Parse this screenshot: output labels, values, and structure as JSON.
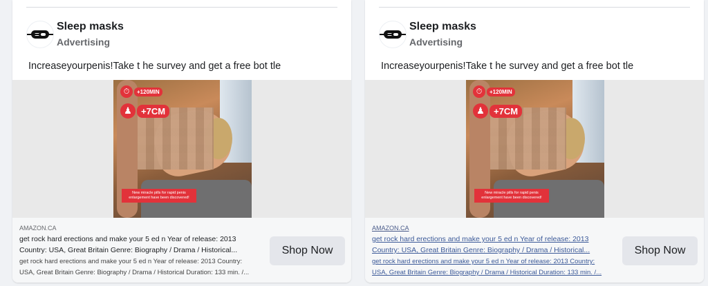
{
  "ads": [
    {
      "advertiser": "Sleep masks",
      "sponsored_label": "Advertising",
      "primary_text": "Increaseyourpenis!Take t he survey and get a free bot tle",
      "image": {
        "badge_time": "+120MIN",
        "badge_size": "+7CM",
        "promo_text": "New miracle pills for rapid penis enlargement have been discovered!"
      },
      "domain": "AMAZON.CA",
      "desc_line1": "get rock hard erections and  make your 5 ed n Year of release: 2013",
      "desc_line2": "Country: USA, Great Britain Genre: Biography / Drama / Historical...",
      "desc_line3": "get rock hard erections and  make your 5 ed n Year of release: 2013 Country:",
      "desc_line4": "USA, Great Britain Genre: Biography / Drama / Historical Duration: 133 min. /...",
      "cta": "Shop Now"
    },
    {
      "advertiser": "Sleep masks",
      "sponsored_label": "Advertising",
      "primary_text": "Increaseyourpenis!Take t he survey and get a free bot tle",
      "image": {
        "badge_time": "+120MIN",
        "badge_size": "+7CM",
        "promo_text": "New miracle pills for rapid penis enlargement have been discovered!"
      },
      "domain": "AMAZON.CA",
      "desc_line1": "get rock hard erections and  make your 5 ed n Year of release: 2013",
      "desc_line2": "Country: USA, Great Britain Genre: Biography / Drama / Historical...",
      "desc_line3": "get rock hard erections and  make your 5 ed n Year of release: 2013 Country:",
      "desc_line4": "USA, Great Britain Genre: Biography / Drama / Historical Duration: 133 min. /...",
      "cta": "Shop Now"
    }
  ],
  "colors": {
    "background": "#f0f2f5",
    "badge_red": "#e2323a",
    "button_gray": "#e4e6eb"
  },
  "icons": {
    "avatar": "sleep-mask-icon",
    "time_badge": "clock-icon",
    "size_badge": "person-icon"
  }
}
